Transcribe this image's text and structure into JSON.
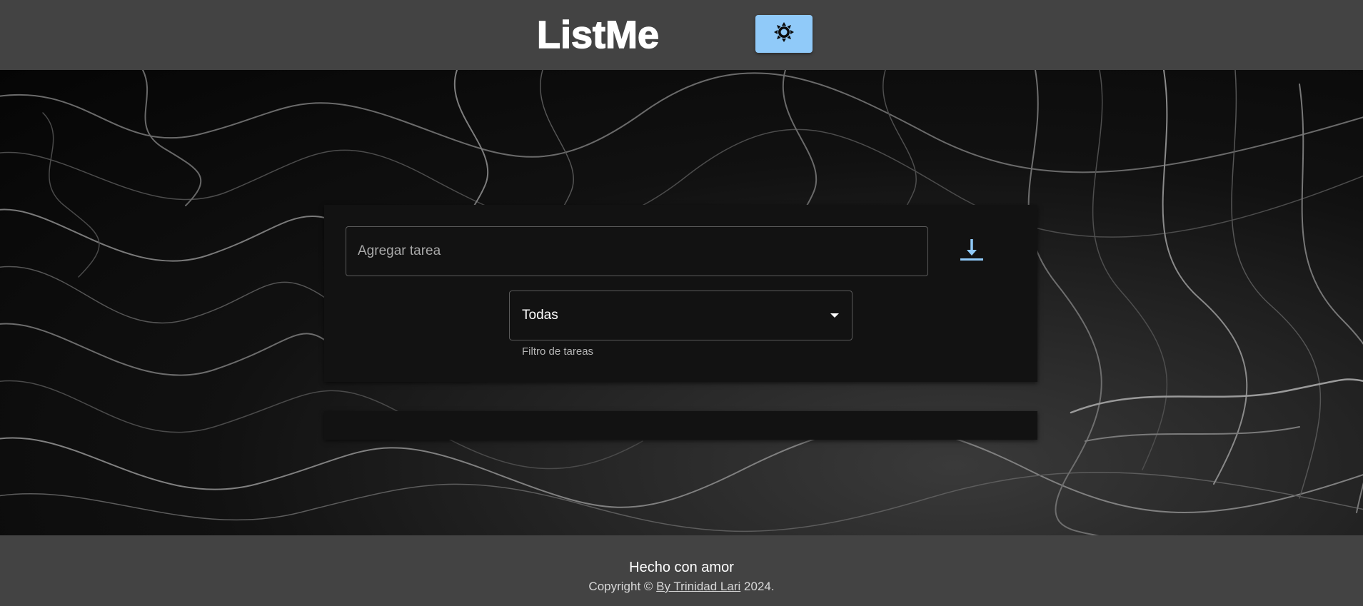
{
  "header": {
    "logo_text": "ListMe",
    "theme_toggle_icon": "sun-icon"
  },
  "form": {
    "task_placeholder": "Agregar tarea",
    "save_icon": "download-icon",
    "filter_value": "Todas",
    "filter_helper": "Filtro de tareas"
  },
  "footer": {
    "title": "Hecho con amor",
    "copy_prefix": "Copyright ©",
    "author_link": "By Trinidad Lari",
    "copy_suffix": "2024."
  },
  "colors": {
    "accent": "#90caf9",
    "header_bg": "#434343",
    "panel_bg": "#121212"
  }
}
